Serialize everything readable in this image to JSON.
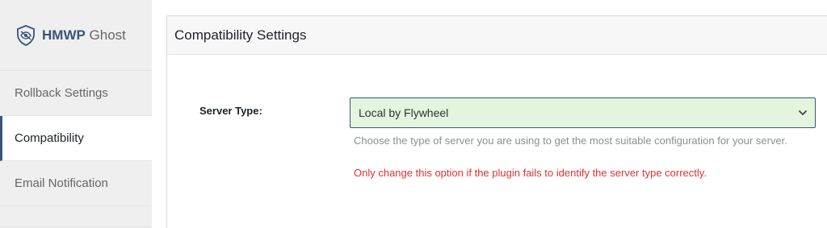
{
  "app": {
    "brand_bold": "HMWP",
    "brand_rest": " Ghost"
  },
  "sidebar": {
    "items": [
      {
        "label": "Rollback Settings"
      },
      {
        "label": "Compatibility"
      },
      {
        "label": "Email Notification"
      }
    ],
    "active_index": 1
  },
  "panel": {
    "title": "Compatibility Settings",
    "server_type": {
      "label": "Server Type:",
      "selected": "Local by Flywheel",
      "help": "Choose the type of server you are using to get the most suitable configuration for your server.",
      "warning": "Only change this option if the plugin fails to identify the server type correctly."
    }
  },
  "colors": {
    "accent": "#3a5577",
    "select_bg": "#e3f5dc",
    "warning": "#e03131"
  },
  "icons": {
    "logo": "shield-eye-icon",
    "dropdown": "chevron-down-icon"
  }
}
